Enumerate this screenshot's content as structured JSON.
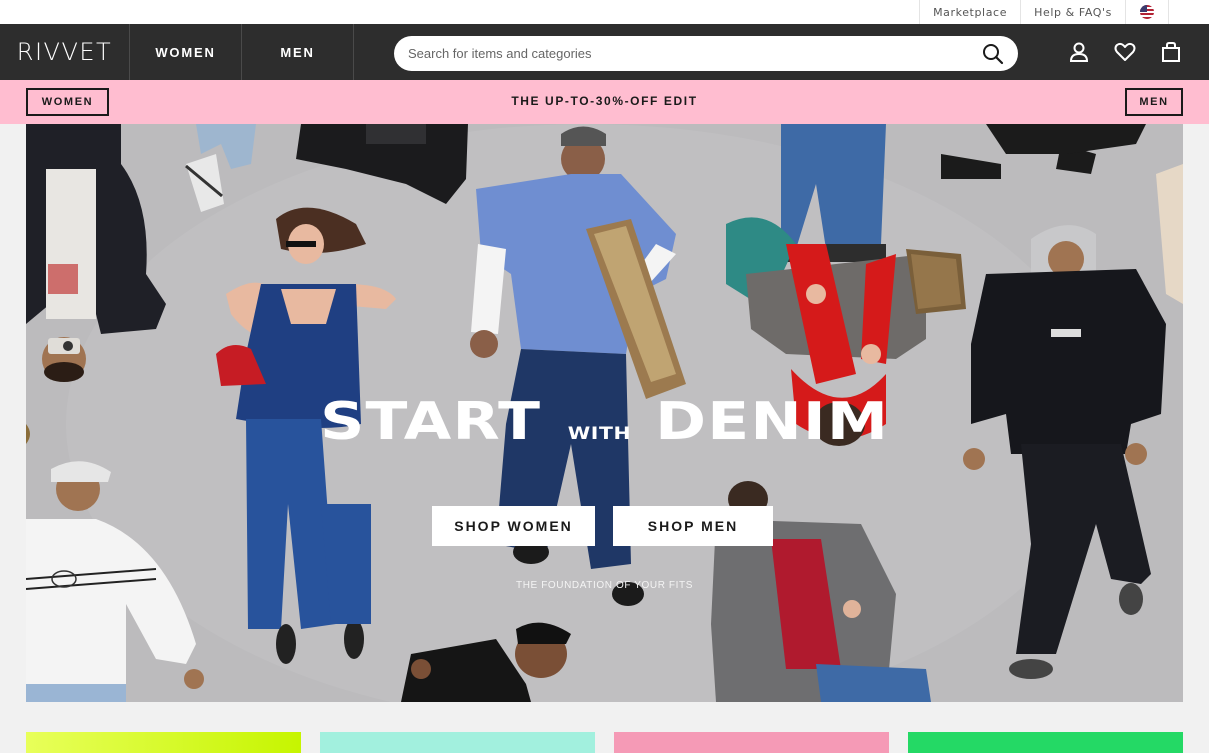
{
  "utility": {
    "links": [
      "Marketplace",
      "Help & FAQ's"
    ],
    "flag_icon": "us-flag-icon"
  },
  "header": {
    "logo": "RIVVET",
    "tabs": [
      "WOMEN",
      "MEN"
    ],
    "search_placeholder": "Search for items and categories",
    "icons": [
      "account-icon",
      "heart-icon",
      "bag-icon"
    ],
    "background": "#2d2d2d"
  },
  "promo": {
    "left_label": "WOMEN",
    "text": "THE UP-TO-30%-OFF EDIT",
    "right_label": "MEN",
    "background": "#ffbdd0"
  },
  "hero": {
    "headline_start": "START",
    "headline_with": "WITH",
    "headline_end": "DENIM",
    "cta_women": "SHOP WOMEN",
    "cta_men": "SHOP MEN",
    "tagline": "THE FOUNDATION OF YOUR FITS"
  },
  "tiles": {
    "colors": [
      "#d4fb1e",
      "#a2f0de",
      "#f59ab6",
      "#24d965"
    ]
  }
}
